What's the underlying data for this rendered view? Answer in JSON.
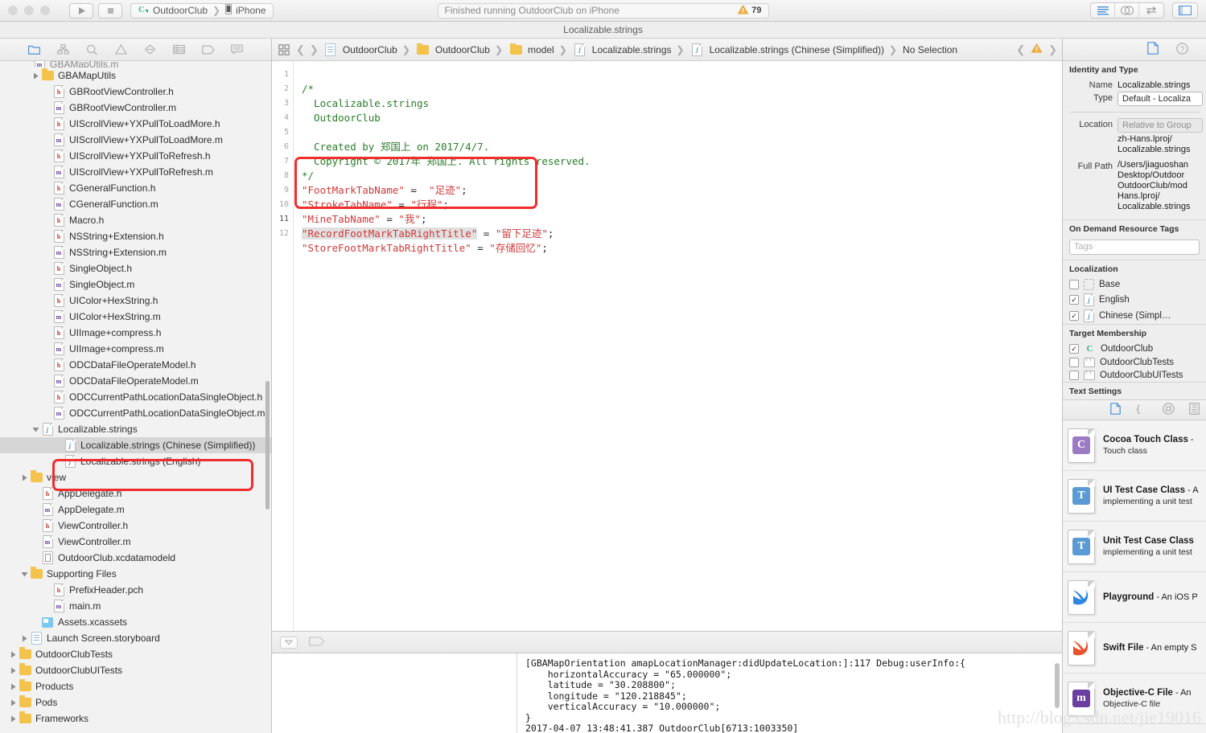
{
  "toolbar": {
    "run_label": "run-button",
    "stop_label": "stop-button",
    "scheme_target": "OutdoorClub",
    "scheme_device": "iPhone",
    "activity_status": "Finished running OutdoorClub on iPhone",
    "issue_count": "79"
  },
  "titlebar": {
    "title": "Localizable.strings"
  },
  "navigator": {
    "toolbar_icons": [
      "folder-icon",
      "sourcecontrol-icon",
      "search-icon",
      "warning-icon",
      "breakpoint-icon",
      "report-icon",
      "tag-icon",
      "comment-icon"
    ],
    "items": [
      {
        "label": "GBAMapUtils",
        "icon": "folder",
        "indent": 2,
        "arrow": "closed"
      },
      {
        "label": "GBRootViewController.h",
        "icon": "h",
        "indent": 3
      },
      {
        "label": "GBRootViewController.m",
        "icon": "m",
        "indent": 3
      },
      {
        "label": "UIScrollView+YXPullToLoadMore.h",
        "icon": "h",
        "indent": 3
      },
      {
        "label": "UIScrollView+YXPullToLoadMore.m",
        "icon": "m",
        "indent": 3
      },
      {
        "label": "UIScrollView+YXPullToRefresh.h",
        "icon": "h",
        "indent": 3
      },
      {
        "label": "UIScrollView+YXPullToRefresh.m",
        "icon": "m",
        "indent": 3
      },
      {
        "label": "CGeneralFunction.h",
        "icon": "h",
        "indent": 3
      },
      {
        "label": "CGeneralFunction.m",
        "icon": "m",
        "indent": 3
      },
      {
        "label": "Macro.h",
        "icon": "h",
        "indent": 3
      },
      {
        "label": "NSString+Extension.h",
        "icon": "h",
        "indent": 3
      },
      {
        "label": "NSString+Extension.m",
        "icon": "m",
        "indent": 3
      },
      {
        "label": "SingleObject.h",
        "icon": "h",
        "indent": 3
      },
      {
        "label": "SingleObject.m",
        "icon": "m",
        "indent": 3
      },
      {
        "label": "UIColor+HexString.h",
        "icon": "h",
        "indent": 3
      },
      {
        "label": "UIColor+HexString.m",
        "icon": "m",
        "indent": 3
      },
      {
        "label": "UIImage+compress.h",
        "icon": "h",
        "indent": 3
      },
      {
        "label": "UIImage+compress.m",
        "icon": "m",
        "indent": 3
      },
      {
        "label": "ODCDataFileOperateModel.h",
        "icon": "h",
        "indent": 3
      },
      {
        "label": "ODCDataFileOperateModel.m",
        "icon": "m",
        "indent": 3
      },
      {
        "label": "ODCCurrentPathLocationDataSingleObject.h",
        "icon": "h",
        "indent": 3
      },
      {
        "label": "ODCCurrentPathLocationDataSingleObject.m",
        "icon": "m",
        "indent": 3
      },
      {
        "label": "Localizable.strings",
        "icon": "strings",
        "indent": 2,
        "arrow": "open"
      },
      {
        "label": "Localizable.strings (Chinese (Simplified))",
        "icon": "strings",
        "indent": 4,
        "selected": true
      },
      {
        "label": "Localizable.strings (English)",
        "icon": "strings",
        "indent": 4
      },
      {
        "label": "view",
        "icon": "folder",
        "indent": 1,
        "arrow": "closed"
      },
      {
        "label": "AppDelegate.h",
        "icon": "h",
        "indent": 2
      },
      {
        "label": "AppDelegate.m",
        "icon": "m",
        "indent": 2
      },
      {
        "label": "ViewController.h",
        "icon": "h",
        "indent": 2
      },
      {
        "label": "ViewController.m",
        "icon": "m",
        "indent": 2
      },
      {
        "label": "OutdoorClub.xcdatamodeld",
        "icon": "xcdata",
        "indent": 2
      },
      {
        "label": "Supporting Files",
        "icon": "folder",
        "indent": 1,
        "arrow": "open"
      },
      {
        "label": "PrefixHeader.pch",
        "icon": "h",
        "indent": 3
      },
      {
        "label": "main.m",
        "icon": "m",
        "indent": 3
      },
      {
        "label": "Assets.xcassets",
        "icon": "xcassets",
        "indent": 2
      },
      {
        "label": "Launch Screen.storyboard",
        "icon": "storyboard",
        "indent": 1,
        "arrow": "closed"
      },
      {
        "label": "OutdoorClubTests",
        "icon": "folder",
        "indent": 0,
        "arrow": "closed"
      },
      {
        "label": "OutdoorClubUITests",
        "icon": "folder",
        "indent": 0,
        "arrow": "closed"
      },
      {
        "label": "Products",
        "icon": "folder",
        "indent": 0,
        "arrow": "closed"
      },
      {
        "label": "Pods",
        "icon": "folder",
        "indent": 0,
        "arrow": "closed"
      },
      {
        "label": "Frameworks",
        "icon": "folder",
        "indent": 0,
        "arrow": "closed"
      }
    ]
  },
  "jumpbar": {
    "crumbs": [
      {
        "label": "OutdoorClub",
        "icon": "project"
      },
      {
        "label": "OutdoorClub",
        "icon": "folder"
      },
      {
        "label": "model",
        "icon": "folder"
      },
      {
        "label": "Localizable.strings",
        "icon": "strings"
      },
      {
        "label": "Localizable.strings (Chinese (Simplified))",
        "icon": "strings"
      },
      {
        "label": "No Selection",
        "icon": "none"
      }
    ]
  },
  "code": {
    "lines": [
      "1",
      "2",
      "3",
      "4",
      "5",
      "6",
      "7",
      "8",
      "9",
      "10",
      "11",
      "12"
    ],
    "line1": "/*",
    "line2": "  Localizable.strings",
    "line3": "  OutdoorClub",
    "line4": "",
    "line5": "  Created by 郑国上 on 2017/4/7.",
    "line6": "  Copyright © 2017年 郑国上. All rights reserved.",
    "line7": "*/",
    "line8_key": "\"FootMarkTabName\"",
    "line8_mid": " =  ",
    "line8_val": "\"足迹\"",
    "line8_end": ";",
    "line9_key": "\"StrokeTabName\"",
    "line9_mid": " = ",
    "line9_val": "\"行程\"",
    "line9_end": ";",
    "line10_key": "\"MineTabName\"",
    "line10_mid": " = ",
    "line10_val": "\"我\"",
    "line10_end": ";",
    "line11_key": "\"RecordFootMarkTabRightTitle\"",
    "line11_mid": " = ",
    "line11_val": "\"留下足迹\"",
    "line11_end": ";",
    "line12_key": "\"StoreFootMarkTabRightTitle\"",
    "line12_mid": " = ",
    "line12_val": "\"存储回忆\"",
    "line12_end": ";"
  },
  "console": {
    "text": "[GBAMapOrientation amapLocationManager:didUpdateLocation:]:117 Debug:userInfo:{\n    horizontalAccuracy = \"65.000000\";\n    latitude = \"30.208800\";\n    longitude = \"120.218845\";\n    verticalAccuracy = \"10.000000\";\n}\n2017-04-07 13:48:41.387 OutdoorClub[6713:1003350]"
  },
  "inspector": {
    "identity": {
      "section_title": "Identity and Type",
      "name_label": "Name",
      "name_value": "Localizable.strings",
      "type_label": "Type",
      "type_value": "Default - Localiza",
      "location_label": "Location",
      "location_value": "Relative to Group",
      "location_path": "zh-Hans.lproj/\nLocalizable.strings",
      "fullpath_label": "Full Path",
      "fullpath_value": "/Users/jiaguoshan\nDesktop/Outdoor\nOutdoorClub/mod\nHans.lproj/\nLocalizable.strings"
    },
    "ondemand": {
      "section_title": "On Demand Resource Tags",
      "tags_placeholder": "Tags"
    },
    "localization": {
      "section_title": "Localization",
      "items": [
        {
          "label": "Base",
          "checked": false,
          "icon": "base"
        },
        {
          "label": "English",
          "checked": true,
          "icon": "strings"
        },
        {
          "label": "Chinese (Simpl…",
          "checked": true,
          "icon": "strings"
        }
      ]
    },
    "target_membership": {
      "section_title": "Target Membership",
      "items": [
        {
          "label": "OutdoorClub",
          "checked": true,
          "icon": "app"
        },
        {
          "label": "OutdoorClubTests",
          "checked": false,
          "icon": "tests"
        },
        {
          "label": "OutdoorClubUITests",
          "checked": false,
          "icon": "tests"
        }
      ]
    },
    "text_settings": {
      "section_title": "Text Settings"
    },
    "library": {
      "toolbar_icons": [
        "file-template-icon",
        "code-snippet-icon",
        "object-library-icon",
        "media-library-icon"
      ],
      "items": [
        {
          "title": "Cocoa Touch Class",
          "dash": " - ",
          "desc": "",
          "sub": "Touch class",
          "badge": "C",
          "color": "#9b7bc4"
        },
        {
          "title": "UI Test Case Class",
          "dash": " - A",
          "desc": "",
          "sub": "implementing a unit test",
          "badge": "T",
          "color": "#5b9bd5"
        },
        {
          "title": "Unit Test Case Class",
          "dash": "",
          "desc": "",
          "sub": "implementing a unit test",
          "badge": "T",
          "color": "#5b9bd5"
        },
        {
          "title": "Playground",
          "dash": " - ",
          "desc": "An iOS P",
          "sub": "",
          "badge": "swift",
          "color": "#2e86de"
        },
        {
          "title": "Swift File",
          "dash": " - ",
          "desc": "An empty S",
          "sub": "",
          "badge": "swift",
          "color": "#e8522d"
        },
        {
          "title": "Objective-C File",
          "dash": " - ",
          "desc": "An ",
          "sub": "Objective-C file",
          "badge": "m",
          "color": "#6b3fa0"
        }
      ]
    }
  },
  "watermark": {
    "text": "http://blog.csdn.net/jie19016"
  }
}
